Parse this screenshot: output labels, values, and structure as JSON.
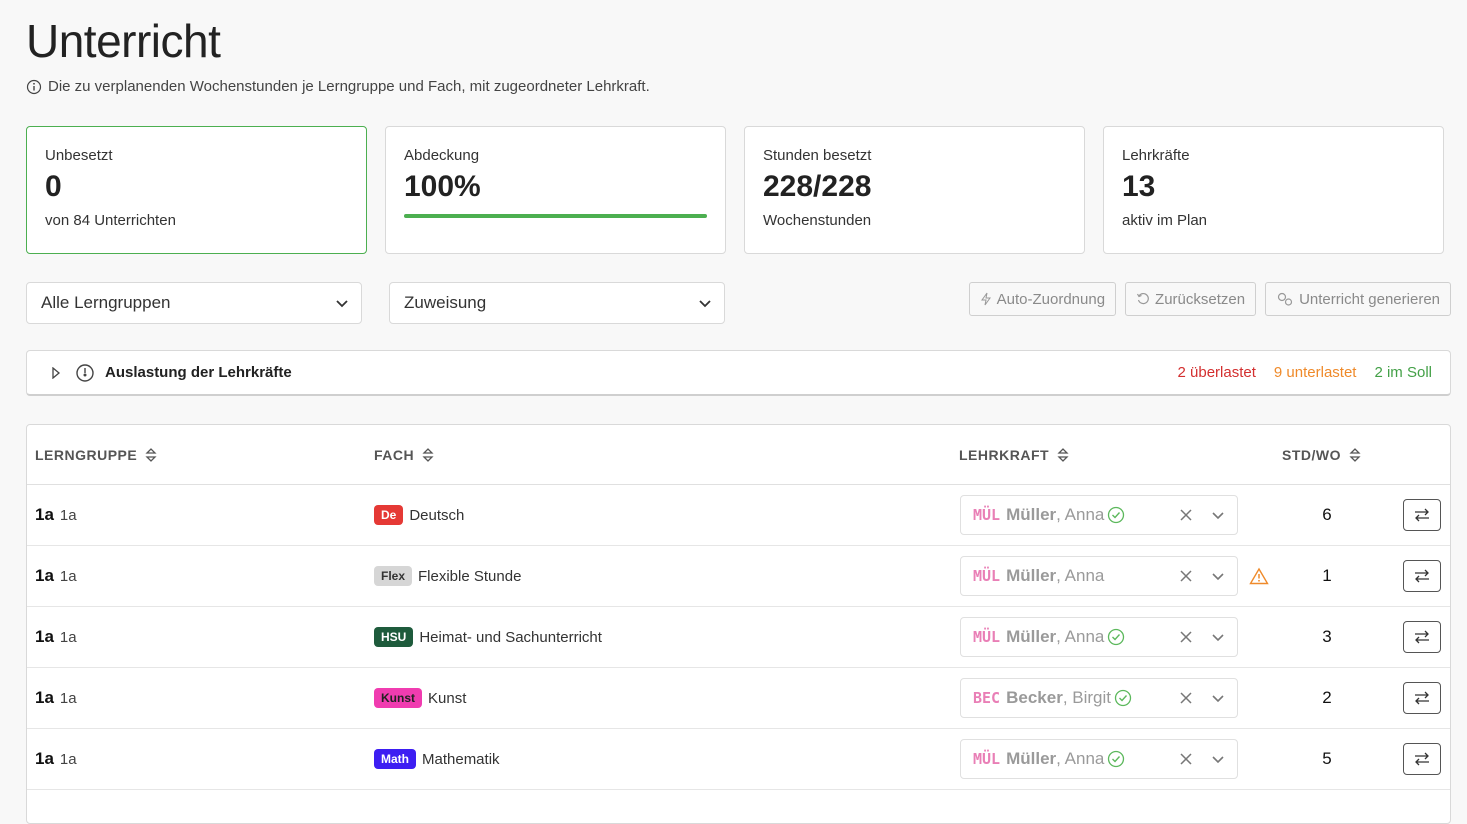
{
  "page": {
    "title": "Unterricht",
    "subtitle": "Die zu verplanenden Wochenstunden je Lerngruppe und Fach, mit zugeordneter Lehrkraft."
  },
  "stats": [
    {
      "label": "Unbesetzt",
      "value": "0",
      "sub": "von 84 Unterrichten"
    },
    {
      "label": "Abdeckung",
      "value": "100%",
      "progress": 1.0
    },
    {
      "label": "Stunden besetzt",
      "value": "228/228",
      "sub": "Wochenstunden"
    },
    {
      "label": "Lehrkräfte",
      "value": "13",
      "sub": "aktiv im Plan"
    }
  ],
  "filters": {
    "group": "Alle Lerngruppen",
    "assignment": "Zuweisung"
  },
  "actions": {
    "auto": "Auto-Zuordnung",
    "reset": "Zurücksetzen",
    "generate": "Unterricht generieren"
  },
  "workload": {
    "title": "Auslastung der Lehrkräfte",
    "overloaded": "2 überlastet",
    "underloaded": "9 unterlastet",
    "ok": "2 im Soll"
  },
  "table": {
    "headers": {
      "group": "LERNGRUPPE",
      "subject": "FACH",
      "teacher": "LEHRKRAFT",
      "hours": "STD/WO"
    },
    "rows": [
      {
        "group": "1a",
        "group_sub": "1a",
        "tag": "De",
        "tag_color": "#e53935",
        "tag_text_color": "#ffffff",
        "subject": "Deutsch",
        "code": "MÜL",
        "last": "Müller",
        "first": ", Anna",
        "status": "ok",
        "hours": "6"
      },
      {
        "group": "1a",
        "group_sub": "1a",
        "tag": "Flex",
        "tag_color": "#d6d6d6",
        "tag_text_color": "#333333",
        "subject": "Flexible Stunde",
        "code": "MÜL",
        "last": "Müller",
        "first": ", Anna",
        "status": "none",
        "warn": true,
        "hours": "1"
      },
      {
        "group": "1a",
        "group_sub": "1a",
        "tag": "HSU",
        "tag_color": "#1e5b3c",
        "tag_text_color": "#ffffff",
        "subject": "Heimat- und Sachunterricht",
        "code": "MÜL",
        "last": "Müller",
        "first": ", Anna",
        "status": "ok",
        "hours": "3"
      },
      {
        "group": "1a",
        "group_sub": "1a",
        "tag": "Kunst",
        "tag_color": "#f03cb0",
        "tag_text_color": "#222222",
        "subject": "Kunst",
        "code": "BEC",
        "last": "Becker",
        "first": ", Birgit",
        "status": "ok",
        "hours": "2"
      },
      {
        "group": "1a",
        "group_sub": "1a",
        "tag": "Math",
        "tag_color": "#3d1ef2",
        "tag_text_color": "#ffffff",
        "subject": "Mathematik",
        "code": "MÜL",
        "last": "Müller",
        "first": ", Anna",
        "status": "ok",
        "hours": "5"
      }
    ]
  }
}
